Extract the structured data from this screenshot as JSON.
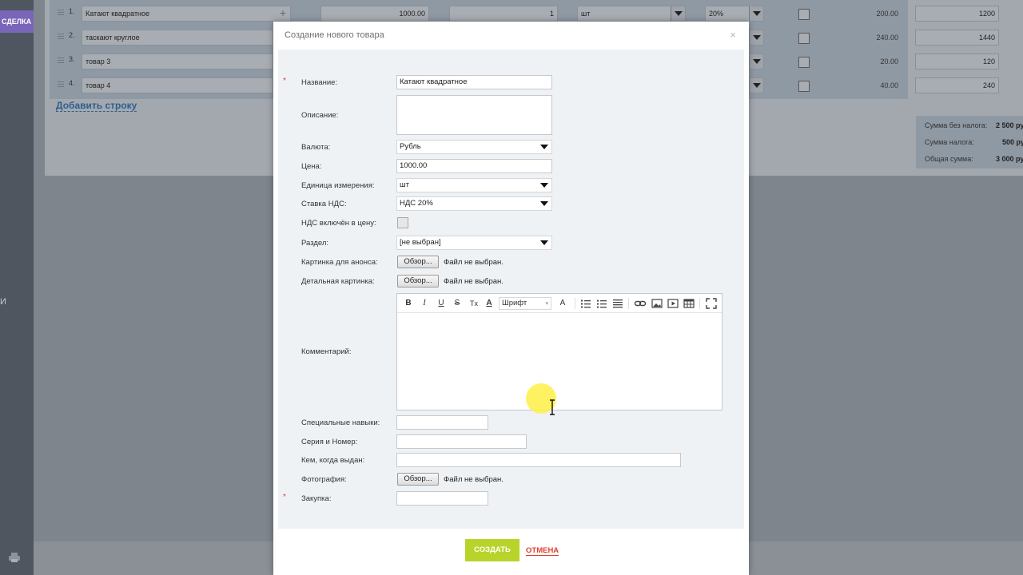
{
  "sidebar": {
    "deal_tab": "СДЕЛКА",
    "side_letter": "И"
  },
  "table": {
    "rows": [
      {
        "num": "1.",
        "name": "Катают квадратное",
        "price": "1000.00",
        "qty": "1",
        "unit": "шт",
        "vat": "20%",
        "tax_sum": "200.00",
        "total": "1200"
      },
      {
        "num": "2.",
        "name": "таскают круглое",
        "price": "",
        "qty": "",
        "unit": "",
        "vat": "",
        "tax_sum": "240.00",
        "total": "1440"
      },
      {
        "num": "3.",
        "name": "товар 3",
        "price": "",
        "qty": "",
        "unit": "",
        "vat": "",
        "tax_sum": "20.00",
        "total": "120"
      },
      {
        "num": "4.",
        "name": "товар 4",
        "price": "",
        "qty": "",
        "unit": "",
        "vat": "",
        "tax_sum": "40.00",
        "total": "240"
      }
    ],
    "add_row_label": "Добавить строку"
  },
  "summary": {
    "no_tax_label": "Сумма без налога:",
    "no_tax_value": "2 500 ру",
    "tax_label": "Сумма налога:",
    "tax_value": "500 ру",
    "total_label": "Общая сумма:",
    "total_value": "3 000 ру"
  },
  "dialog": {
    "title": "Создание нового товара",
    "close": "×",
    "fields": {
      "name_label": "Название:",
      "name_value": "Катают квадратное",
      "description_label": "Описание:",
      "currency_label": "Валюта:",
      "currency_value": "Рубль",
      "price_label": "Цена:",
      "price_value": "1000.00",
      "unit_label": "Единица измерения:",
      "unit_value": "шт",
      "vat_label": "Ставка НДС:",
      "vat_value": "НДС 20%",
      "vat_included_label": "НДС включён в цену:",
      "section_label": "Раздел:",
      "section_value": "[не выбран]",
      "preview_image_label": "Картинка для анонса:",
      "detail_image_label": "Детальная картинка:",
      "comment_label": "Комментарий:",
      "skills_label": "Специальные навыки:",
      "series_label": "Серия и Номер:",
      "issued_label": "Кем, когда выдан:",
      "photo_label": "Фотография:",
      "purchase_label": "Закупка:"
    },
    "browse_label": "Обзор...",
    "no_file_label": "Файл не выбран.",
    "editor": {
      "bold": "B",
      "italic": "I",
      "underline": "U",
      "strike": "S",
      "clear": "Tx",
      "font_color": "A",
      "font_label": "Шрифт",
      "font_size": "A"
    },
    "create_button": "СОЗДАТЬ",
    "cancel_button": "ОТМЕНА"
  }
}
